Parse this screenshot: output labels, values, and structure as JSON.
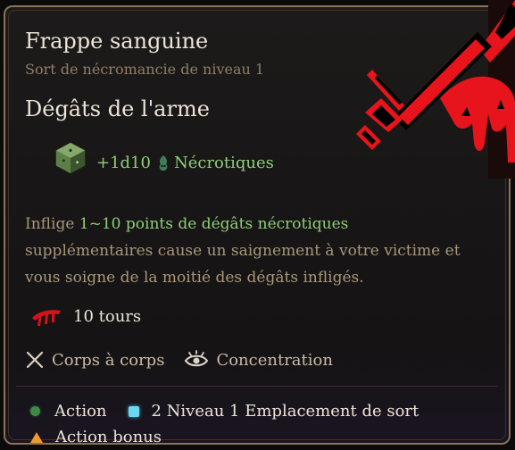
{
  "spell": {
    "name": "Frappe sanguine",
    "school": "Sort de nécromancie de niveau 1"
  },
  "damage": {
    "heading": "Dégâts de l'arme",
    "amount": "+1d10",
    "type": "Nécrotiques",
    "icons": [
      "dice-icon",
      "necrotic-icon"
    ]
  },
  "description": {
    "before": "Inflige ",
    "highlight": "1~10 points de dégâts nécrotiques",
    "after": " supplémentaires cause un saignement à votre victime et vous soigne de la moitié des dégâts infligés."
  },
  "duration": {
    "text": "10 tours",
    "icon": "bleeding-icon"
  },
  "tags": [
    {
      "label": "Corps à corps",
      "icon": "crossed-swords-icon"
    },
    {
      "label": "Concentration",
      "icon": "concentration-eye-icon"
    }
  ],
  "costs": {
    "action": "Action",
    "spell_slot": "2 Niveau 1 Emplacement de sort",
    "bonus_action": "Action bonus"
  },
  "colors": {
    "accent_green": "#8dcf78",
    "border_gold": "#8a7357",
    "blood_red": "#e8141c"
  }
}
